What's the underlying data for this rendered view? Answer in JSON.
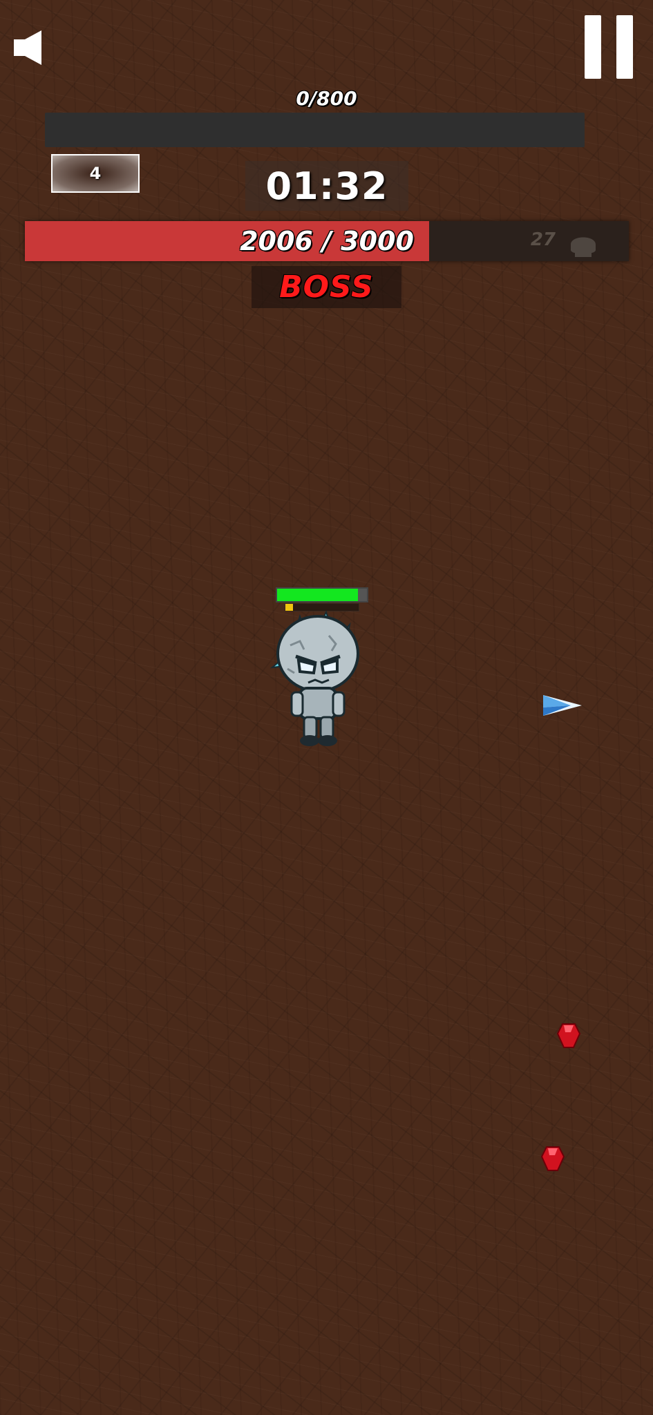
{
  "hud": {
    "xp_text": "0/800",
    "xp_current": 0,
    "xp_max": 800,
    "level": "4",
    "timer": "01:32",
    "boss_hp_text": "2006 / 3000",
    "boss_hp_current": 2006,
    "boss_hp_max": 3000,
    "kill_count": "27",
    "boss_label": "BOSS"
  },
  "player": {
    "hp_fraction": 0.9,
    "xp_fraction": 0.1
  },
  "icons": {
    "sound": "speaker-icon",
    "pause": "pause-icon",
    "skull": "skull-icon",
    "gem": "red-gem-icon",
    "projectile": "ice-shard-icon"
  },
  "colors": {
    "boss_hp": "#c93838",
    "player_hp": "#13e71f",
    "player_xp": "#f1c40f",
    "boss_label": "#ff1a1a"
  }
}
